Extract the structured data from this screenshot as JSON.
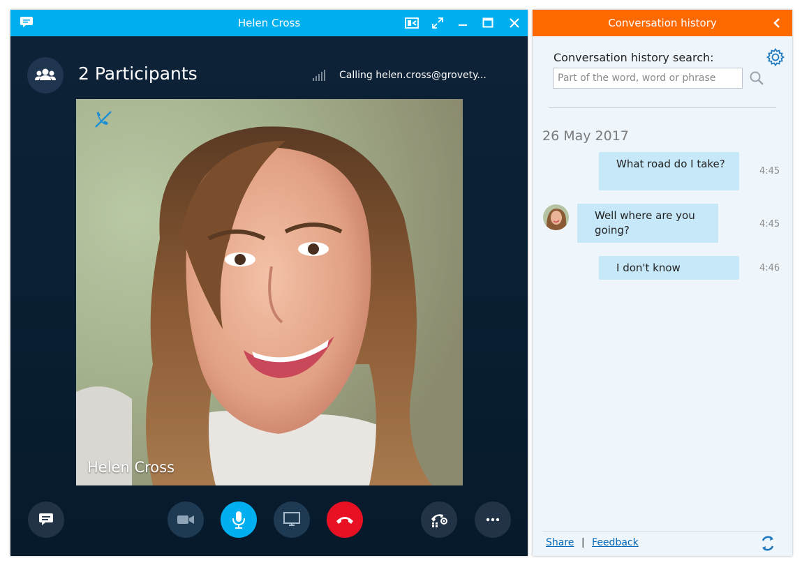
{
  "call_window": {
    "title": "Helen Cross",
    "participants_label": "2 Participants",
    "calling_status": "Calling helen.cross@grovety...",
    "video_name": "Helen Cross"
  },
  "history": {
    "title": "Conversation history",
    "search_label": "Conversation history search:",
    "search_placeholder": "Part of the word, word or phrase",
    "date": "26 May 2017",
    "messages": [
      {
        "text": "What road do I take?",
        "time": "4:45",
        "from": "self"
      },
      {
        "text": "Well where are you going?",
        "time": "4:45",
        "from": "contact"
      },
      {
        "text": "I don't know",
        "time": "4:46",
        "from": "self"
      }
    ],
    "footer": {
      "share": "Share",
      "separator": "|",
      "feedback": "Feedback"
    }
  },
  "colors": {
    "call_titlebar": "#00aff0",
    "history_header": "#ff6a00",
    "mic_active": "#00aff0",
    "end_call": "#e81123",
    "bubble": "#c6e8f8"
  },
  "icons": [
    "chat-icon",
    "compact-view-icon",
    "fullscreen-icon",
    "minimize-icon",
    "maximize-icon",
    "close-icon",
    "participants-icon",
    "signal-icon",
    "mic-muted-indicator-icon",
    "video-camera-icon",
    "microphone-icon",
    "screen-share-icon",
    "end-call-icon",
    "call-controls-icon",
    "more-icon",
    "back-chevron-icon",
    "gear-icon",
    "search-icon",
    "refresh-icon"
  ]
}
